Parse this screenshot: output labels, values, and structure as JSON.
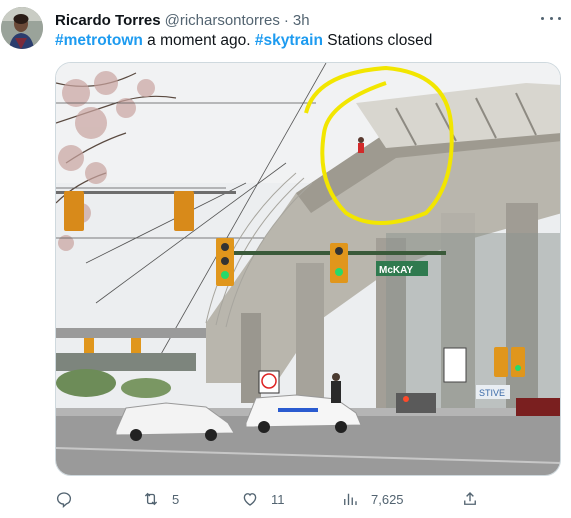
{
  "author": {
    "name": "Ricardo Torres",
    "handle": "@richarsontorres",
    "separator": "·",
    "time": "3h"
  },
  "tweet": {
    "hashtag1": "#metrotown",
    "text1": " a moment ago. ",
    "hashtag2": "#skytrain",
    "text2": " Stations closed"
  },
  "media": {
    "street_sign": "McKAY",
    "bus_sign": "STIVE"
  },
  "actions": {
    "replies": "",
    "retweets": "5",
    "likes": "11",
    "views": "7,625"
  },
  "colors": {
    "accent": "#1d9bf0",
    "secondary_text": "#536471",
    "circle_annotation": "#f2e600"
  },
  "icons": [
    "more-icon",
    "reply-icon",
    "retweet-icon",
    "like-icon",
    "views-icon",
    "share-icon"
  ]
}
